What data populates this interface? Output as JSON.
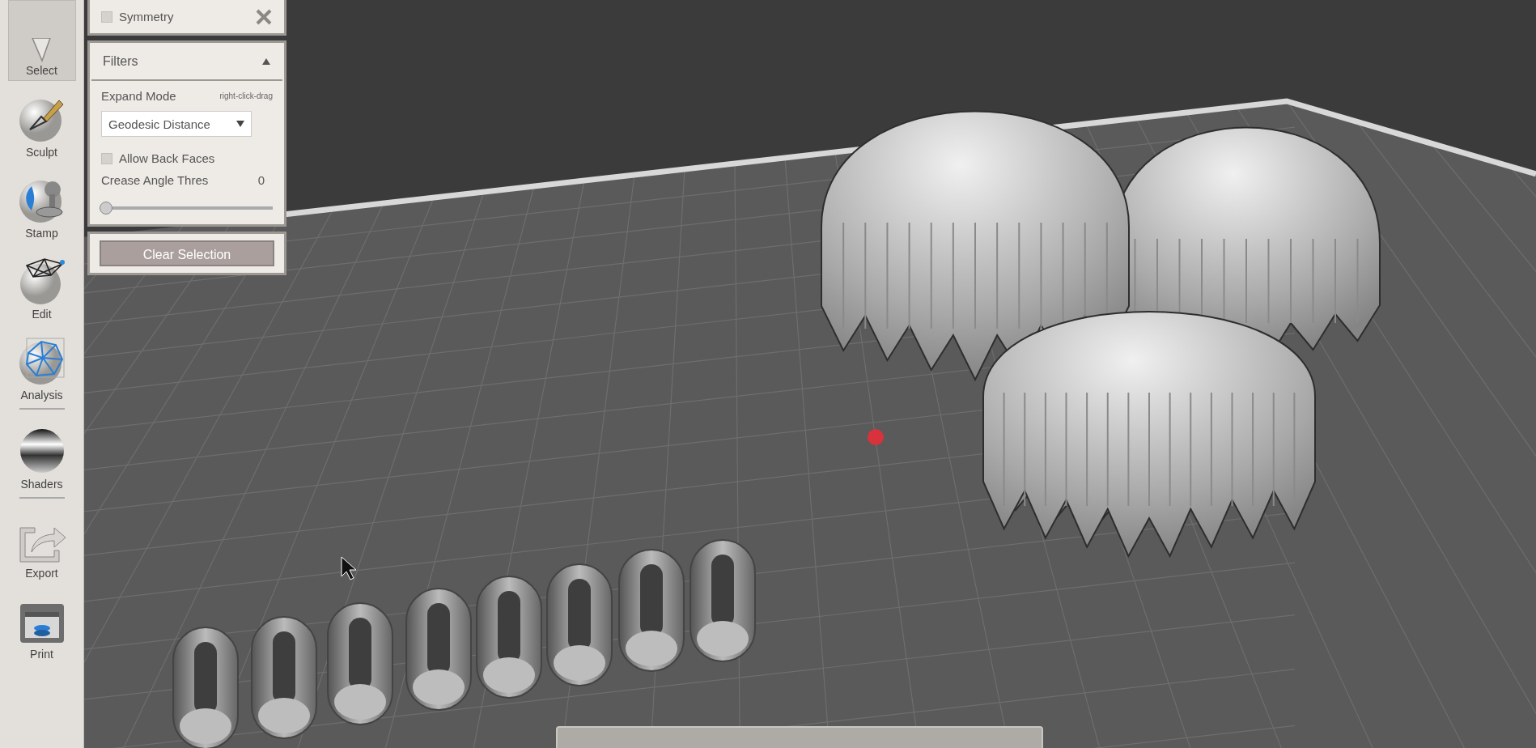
{
  "toolbar": {
    "tools": [
      {
        "label": "Select",
        "selected": true
      },
      {
        "label": "Sculpt",
        "selected": false
      },
      {
        "label": "Stamp",
        "selected": false
      },
      {
        "label": "Edit",
        "selected": false
      },
      {
        "label": "Analysis",
        "selected": false
      },
      {
        "label": "Shaders",
        "selected": false
      },
      {
        "label": "Export",
        "selected": false
      },
      {
        "label": "Print",
        "selected": false
      }
    ]
  },
  "symmetry": {
    "label": "Symmetry",
    "checked": false
  },
  "filters": {
    "title": "Filters",
    "expanded": true,
    "expand_mode": {
      "label": "Expand Mode",
      "hint": "right-click-drag",
      "value": "Geodesic Distance"
    },
    "allow_back_faces": {
      "label": "Allow Back Faces",
      "checked": false
    },
    "crease_angle": {
      "label": "Crease Angle Thres",
      "reading": "0",
      "level": 0
    }
  },
  "clear_selection": {
    "label": "Clear Selection"
  }
}
